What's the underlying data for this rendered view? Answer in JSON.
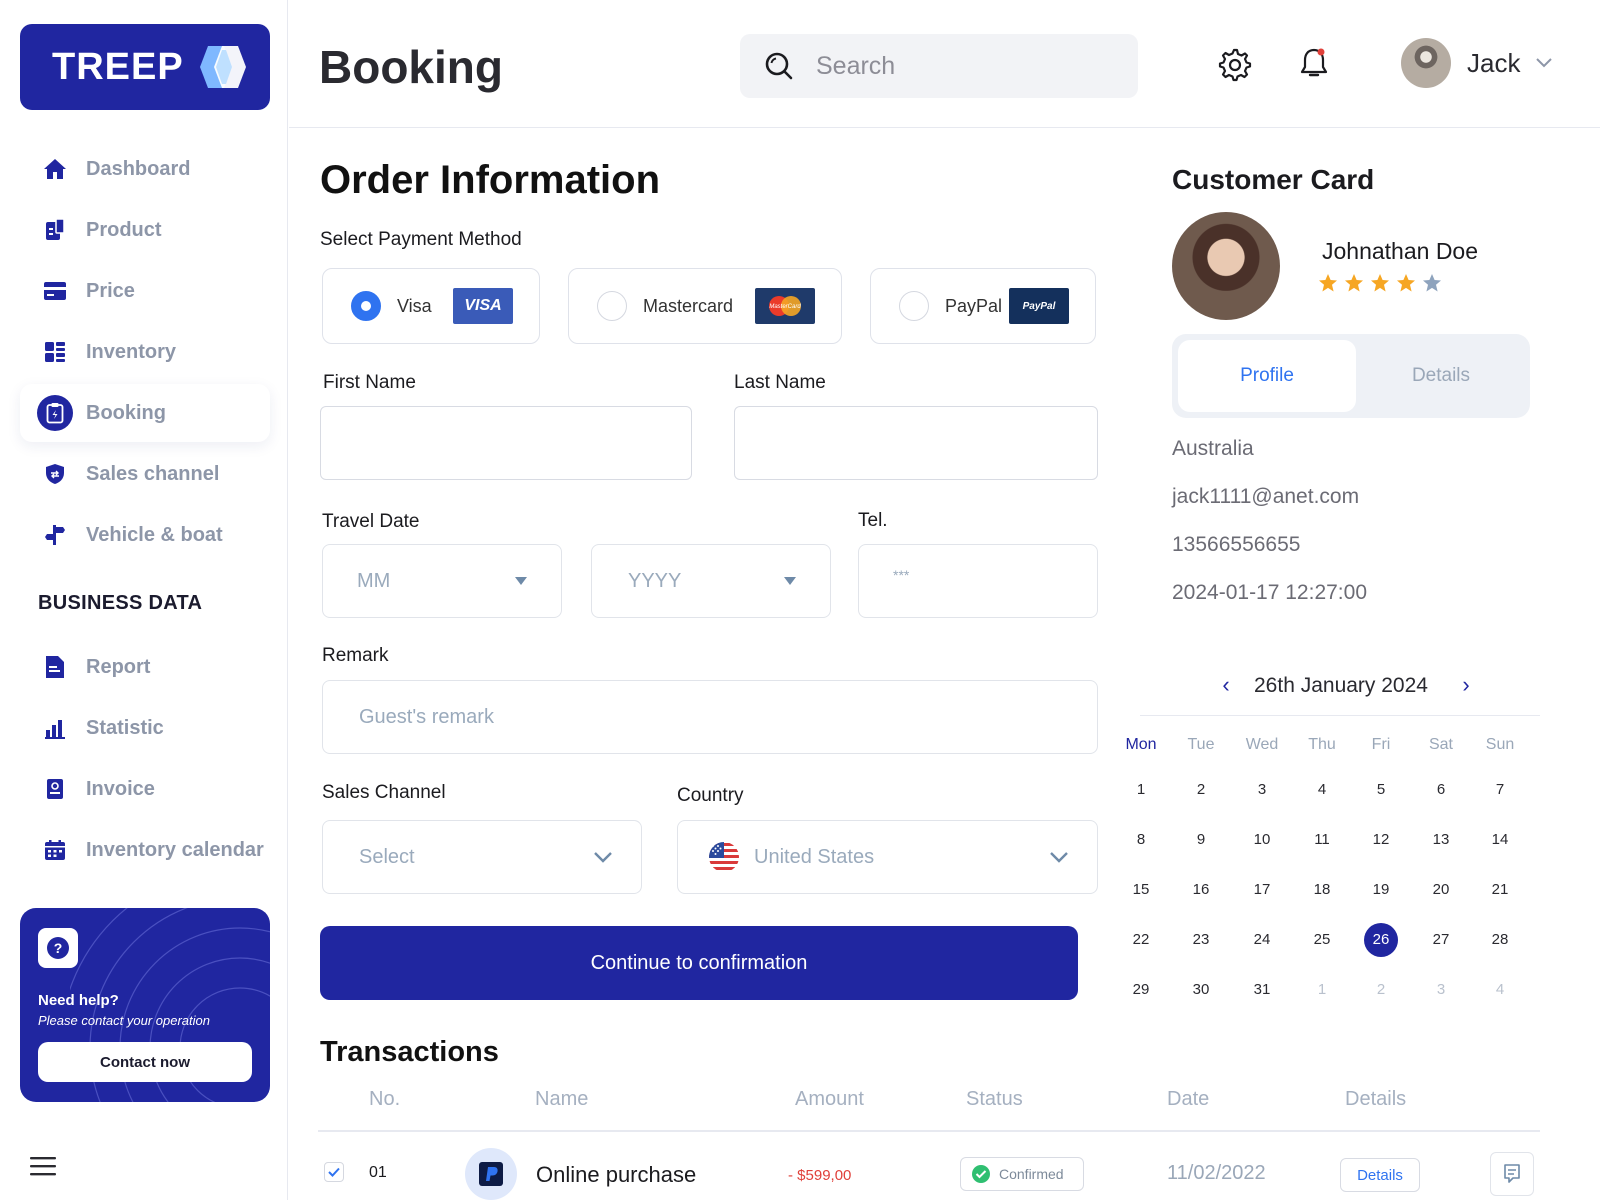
{
  "app": {
    "logo": "TREEP",
    "page_title": "Booking"
  },
  "sidebar": {
    "items": [
      {
        "label": "Dashboard",
        "icon": "home-icon"
      },
      {
        "label": "Product",
        "icon": "product-icon"
      },
      {
        "label": "Price",
        "icon": "card-icon"
      },
      {
        "label": "Inventory",
        "icon": "grid-icon"
      },
      {
        "label": "Booking",
        "icon": "booking-icon",
        "active": true
      },
      {
        "label": "Sales channel",
        "icon": "shield-icon"
      },
      {
        "label": "Vehicle & boat",
        "icon": "signpost-icon"
      }
    ],
    "section_title": "BUSINESS DATA",
    "business_items": [
      {
        "label": "Report",
        "icon": "report-icon"
      },
      {
        "label": "Statistic",
        "icon": "bar-chart-icon"
      },
      {
        "label": "Invoice",
        "icon": "invoice-icon"
      },
      {
        "label": "Inventory calendar",
        "icon": "calendar-icon"
      }
    ],
    "help": {
      "title": "Need help?",
      "subtitle": "Please contact your operation",
      "button": "Contact now"
    }
  },
  "header": {
    "search_placeholder": "Search",
    "user_name": "Jack"
  },
  "order": {
    "title": "Order Information",
    "payment_label": "Select Payment Method",
    "payment_methods": [
      {
        "label": "Visa",
        "selected": true,
        "logo_text": "VISA"
      },
      {
        "label": "Mastercard",
        "selected": false,
        "logo_text": "MasterCard"
      },
      {
        "label": "PayPal",
        "selected": false,
        "logo_text": "PayPal"
      }
    ],
    "first_name_label": "First Name",
    "last_name_label": "Last Name",
    "travel_date_label": "Travel Date",
    "month_placeholder": "MM",
    "year_placeholder": "YYYY",
    "tel_label": "Tel.",
    "tel_placeholder": "***",
    "remark_label": "Remark",
    "remark_placeholder": "Guest's remark",
    "sales_channel_label": "Sales Channel",
    "sales_channel_value": "Select",
    "country_label": "Country",
    "country_value": "United States",
    "submit": "Continue to confirmation"
  },
  "transactions": {
    "title": "Transactions",
    "columns": [
      "No.",
      "Name",
      "Amount",
      "Status",
      "Date",
      "Details"
    ],
    "rows": [
      {
        "no": "01",
        "name": "Online purchase",
        "amount": "- $599,00",
        "status": "Confirmed",
        "date": "11/02/2022",
        "details": "Details"
      }
    ]
  },
  "customer": {
    "title": "Customer Card",
    "name": "Johnathan Doe",
    "rating": 4,
    "rating_max": 5,
    "tabs": [
      "Profile",
      "Details"
    ],
    "country": "Australia",
    "email": "jack1111@anet.com",
    "phone": "13566556655",
    "datetime": "2024-01-17 12:27:00"
  },
  "calendar": {
    "title": "26th January  2024",
    "prev": "‹",
    "next": "›",
    "weekdays": [
      "Mon",
      "Tue",
      "Wed",
      "Thu",
      "Fri",
      "Sat",
      "Sun"
    ],
    "weeks": [
      [
        "1",
        "2",
        "3",
        "4",
        "5",
        "6",
        "7"
      ],
      [
        "8",
        "9",
        "10",
        "11",
        "12",
        "13",
        "14"
      ],
      [
        "15",
        "16",
        "17",
        "18",
        "19",
        "20",
        "21"
      ],
      [
        "22",
        "23",
        "24",
        "25",
        "26",
        "27",
        "28"
      ],
      [
        "29",
        "30",
        "31",
        "1",
        "2",
        "3",
        "4"
      ]
    ],
    "selected": "26",
    "trailing_count": 4
  },
  "colors": {
    "primary": "#2026a0",
    "accent": "#2f73f0",
    "star": "#f6a623",
    "danger": "#e0403a",
    "success": "#2fbf71"
  }
}
